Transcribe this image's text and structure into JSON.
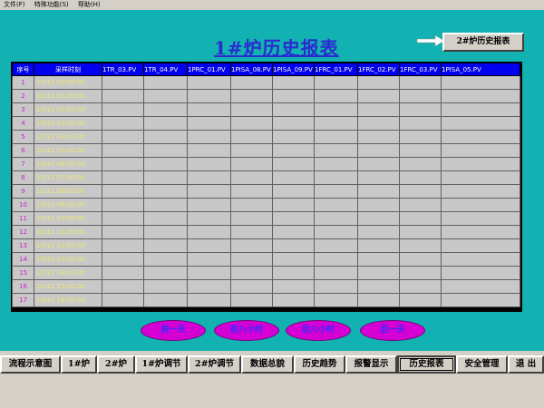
{
  "menu": [
    "文件(F)",
    "特殊功能(S)",
    "帮助(H)"
  ],
  "title": "1#炉历史报表",
  "nav_button": "2#炉历史报表",
  "table": {
    "headers": [
      "序号",
      "采样时刻",
      "1TR_03.PV",
      "1TR_04.PV",
      "1PRC_01.PV",
      "1PISA_08.PV",
      "1PISA_09.PV",
      "1FRC_01.PV",
      "1FRC_02.PV",
      "1FRC_03.PV",
      "1PISA_05.PV"
    ],
    "rows": [
      {
        "idx": "1",
        "time": "10/11 00:00:00"
      },
      {
        "idx": "2",
        "time": "10/11 01:00:00"
      },
      {
        "idx": "3",
        "time": "10/11 02:00:00"
      },
      {
        "idx": "4",
        "time": "10/11 03:00:00"
      },
      {
        "idx": "5",
        "time": "10/11 04:00:00"
      },
      {
        "idx": "6",
        "time": "10/11 05:00:00"
      },
      {
        "idx": "7",
        "time": "10/11 06:00:00"
      },
      {
        "idx": "8",
        "time": "10/11 07:00:00"
      },
      {
        "idx": "9",
        "time": "10/11 08:00:00"
      },
      {
        "idx": "10",
        "time": "10/11 09:00:00"
      },
      {
        "idx": "11",
        "time": "10/11 10:00:00"
      },
      {
        "idx": "12",
        "time": "10/11 11:00:00"
      },
      {
        "idx": "13",
        "time": "10/11 12:00:00"
      },
      {
        "idx": "14",
        "time": "10/11 13:00:00"
      },
      {
        "idx": "15",
        "time": "10/11 14:00:00"
      },
      {
        "idx": "16",
        "time": "10/11 15:00:00"
      },
      {
        "idx": "17",
        "time": "10/11 16:00:00"
      }
    ]
  },
  "time_nav": [
    "前一天",
    "前八小时",
    "后八小时",
    "后一天"
  ],
  "toolbar": [
    "流程示意图",
    "1#炉",
    "2#炉",
    "1#炉调节",
    "2#炉调节",
    "数据总貌",
    "历史趋势",
    "报警显示",
    "历史报表",
    "安全管理",
    "退 出"
  ],
  "colors": {
    "background": "#12b2b2",
    "header": "#0000ee",
    "pill": "#d400d4"
  }
}
